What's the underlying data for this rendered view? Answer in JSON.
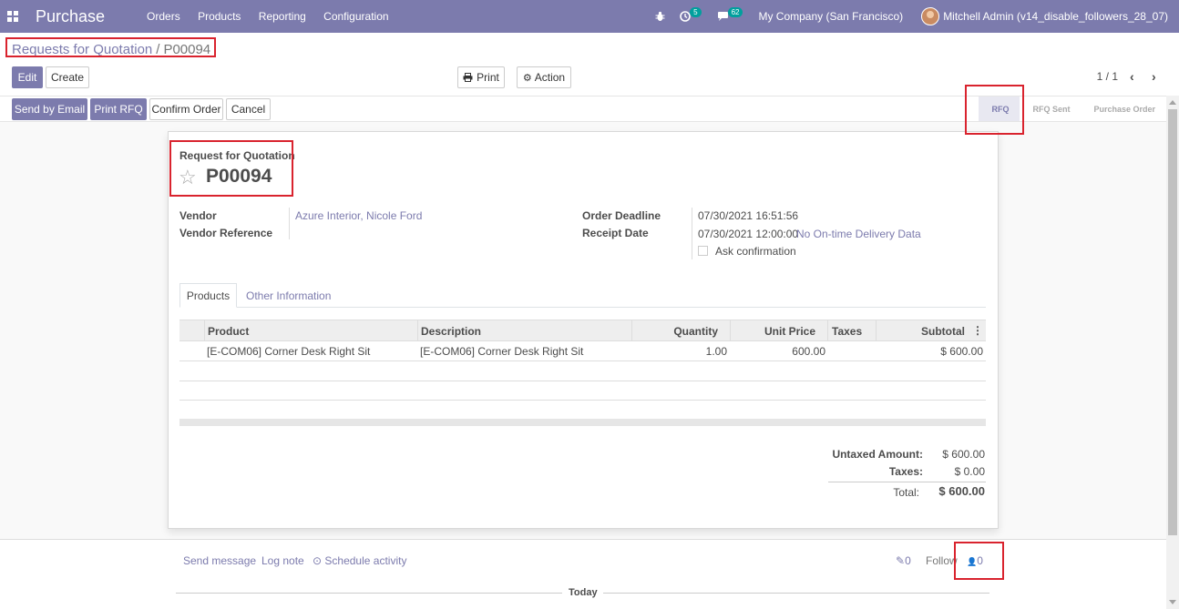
{
  "navbar": {
    "app_title": "Purchase",
    "menu": [
      "Orders",
      "Products",
      "Reporting",
      "Configuration"
    ],
    "activity_count": "5",
    "message_count": "62",
    "company": "My Company (San Francisco)",
    "user": "Mitchell Admin (v14_disable_followers_28_07)"
  },
  "breadcrumb": {
    "parent": "Requests for Quotation",
    "separator": "/",
    "current": "P00094"
  },
  "control": {
    "edit": "Edit",
    "create": "Create",
    "print": "Print",
    "action": "Action",
    "pager": "1 / 1"
  },
  "statusbar": {
    "buttons": [
      "Send by Email",
      "Print RFQ",
      "Confirm Order",
      "Cancel"
    ],
    "steps": [
      "RFQ",
      "RFQ Sent",
      "Purchase Order"
    ],
    "active_step": "RFQ"
  },
  "form": {
    "subtitle": "Request for Quotation",
    "name": "P00094",
    "vendor_label": "Vendor",
    "vendor_value": "Azure Interior, Nicole Ford",
    "vendor_ref_label": "Vendor Reference",
    "order_deadline_label": "Order Deadline",
    "order_deadline_value": "07/30/2021 16:51:56",
    "receipt_date_label": "Receipt Date",
    "receipt_date_value": "07/30/2021 12:00:00",
    "delivery_data_link": "No On-time Delivery Data",
    "ask_confirmation_label": "Ask confirmation"
  },
  "tabs": [
    "Products",
    "Other Information"
  ],
  "table": {
    "headers": [
      "Product",
      "Description",
      "Quantity",
      "Unit Price",
      "Taxes",
      "Subtotal"
    ],
    "rows": [
      {
        "product": "[E-COM06] Corner Desk Right Sit",
        "description": "[E-COM06] Corner Desk Right Sit",
        "quantity": "1.00",
        "unit_price": "600.00",
        "taxes": "",
        "subtotal": "$ 600.00"
      }
    ]
  },
  "totals": {
    "untaxed_label": "Untaxed Amount:",
    "untaxed_value": "$ 600.00",
    "taxes_label": "Taxes:",
    "taxes_value": "$ 0.00",
    "total_label": "Total:",
    "total_value": "$ 600.00"
  },
  "chatter": {
    "send_message": "Send message",
    "log_note": "Log note",
    "schedule_activity": "Schedule activity",
    "attachments_count": "0",
    "follow": "Follow",
    "followers_count": "0",
    "today": "Today"
  },
  "colors": {
    "brand": "#7c7bad",
    "highlight_box": "#d9232e"
  }
}
